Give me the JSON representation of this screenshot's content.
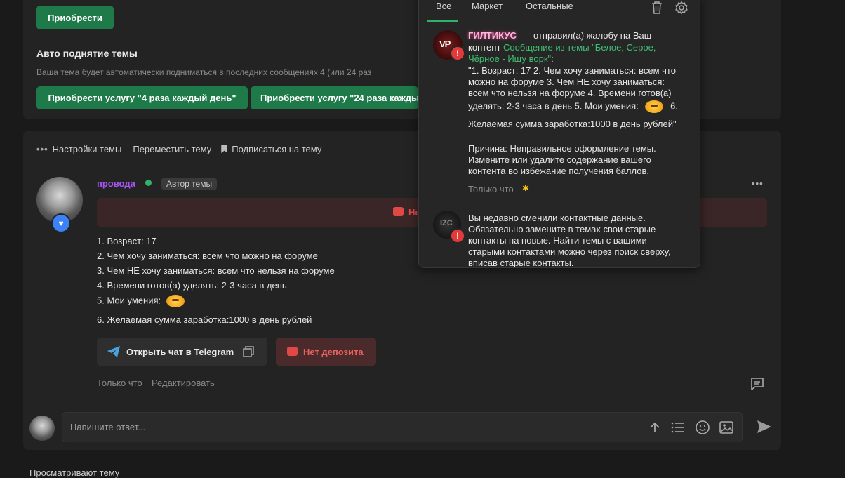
{
  "top_card": {
    "buy_button": "Приобрести",
    "auto_raise_title": "Авто поднятие темы",
    "auto_raise_desc": "Ваша тема будет автоматически подниматься в последних сообщениях 4 (или 24 раз",
    "buy_4_button": "Приобрести услугу \"4 раза каждый день\"",
    "buy_24_button": "Приобрести услугу \"24 раза каждый"
  },
  "thread_actions": {
    "settings": "Настройки темы",
    "move": "Переместить тему",
    "subscribe": "Подписаться на тему"
  },
  "post": {
    "author": "провода",
    "author_badge": "Автор темы",
    "alert_text": "Не",
    "lines": [
      "1. Возраст: 17",
      "2. Чем хочу заниматься: всем что можно на форуме",
      "3. Чем НЕ хочу заниматься: всем что нельзя на форуме",
      "4. Времени готов(а) уделять: 2-3 часа в день",
      "5. Мои умения:",
      "6. Желаемая сумма заработка:1000 в день рублей"
    ],
    "telegram_button": "Открыть чат в Telegram",
    "no_deposit_button": "Нет депозита",
    "time": "Только что",
    "edit": "Редактировать"
  },
  "reply": {
    "placeholder": "Напишите ответ..."
  },
  "footer_text": "Просматривают тему",
  "notifications": {
    "tabs": [
      "Все",
      "Маркет",
      "Остальные"
    ],
    "item1": {
      "user": "ГИЛТИКУС",
      "action": "отправил(а) жалобу на Ваш",
      "content_word": "контент",
      "link": "Сообщение из темы \"Белое, Серое, Чёрное - Ищу ворк\"",
      "colon": ":",
      "quote_lines": [
        "\"1. Возраст: 17 2. Чем хочу заниматься: всем что",
        "можно на форуме 3. Чем НЕ хочу заниматься:",
        "всем что нельзя на форуме 4. Времени готов(а)",
        "уделять: 2-3 часа в день 5. Мои умения:",
        "6.",
        "Желаемая сумма заработка:1000 в день рублей\""
      ],
      "reason_lines": [
        "Причина: Неправильное оформление темы.",
        "Измените или удалите содержание вашего",
        "контента во избежание получения баллов."
      ],
      "time": "Только что"
    },
    "item2": {
      "lines": [
        "Вы недавно сменили контактные данные.",
        "Обязательно замените в темах свои старые",
        "контакты на новые. Найти темы с вашими",
        "старыми контактами можно через поиск сверху,",
        "вписав старые контакты."
      ]
    }
  },
  "colors": {
    "accent_green": "#1f7a4a",
    "author_purple": "#a855f7",
    "danger_red": "#e03a3a",
    "link_green": "#3fbf6f"
  }
}
